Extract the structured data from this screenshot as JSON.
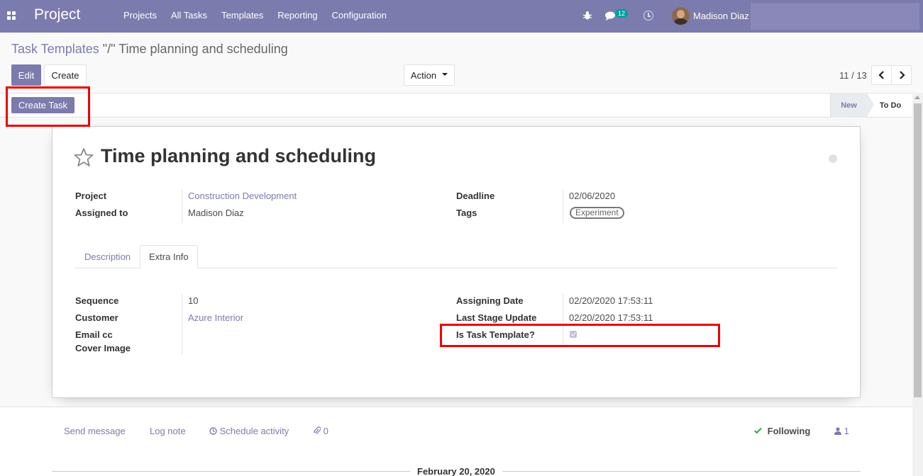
{
  "navbar": {
    "app_name": "Project",
    "menu": [
      "Projects",
      "All Tasks",
      "Templates",
      "Reporting",
      "Configuration"
    ],
    "chat_count": "12",
    "user_name": "Madison Diaz",
    "accent": "#7c7bad"
  },
  "breadcrumb": {
    "parent": "Task Templates",
    "separator": "\"/\"",
    "current": "Time planning and scheduling"
  },
  "buttons": {
    "edit": "Edit",
    "create": "Create",
    "action": "Action",
    "create_task": "Create Task"
  },
  "pager": {
    "value": "11 / 13"
  },
  "stages": {
    "new": "New",
    "todo": "To Do",
    "current": "New"
  },
  "record": {
    "title": "Time planning and scheduling",
    "project_label": "Project",
    "project_value": "Construction Development",
    "assigned_label": "Assigned to",
    "assigned_value": "Madison Diaz",
    "deadline_label": "Deadline",
    "deadline_value": "02/06/2020",
    "tags_label": "Tags",
    "tags_value": "Experiment"
  },
  "tabs": {
    "description": "Description",
    "extra_info": "Extra Info",
    "active": "Extra Info"
  },
  "extra_info": {
    "sequence_label": "Sequence",
    "sequence_value": "10",
    "customer_label": "Customer",
    "customer_value": "Azure Interior",
    "email_cc_label": "Email cc",
    "cover_image_label": "Cover Image",
    "assigning_date_label": "Assigning Date",
    "assigning_date_value": "02/20/2020 17:53:11",
    "last_stage_update_label": "Last Stage Update",
    "last_stage_update_value": "02/20/2020 17:53:11",
    "is_task_template_label": "Is Task Template?",
    "is_task_template_value": true
  },
  "chatter": {
    "send_message": "Send message",
    "log_note": "Log note",
    "schedule_activity": "Schedule activity",
    "attachments": "0",
    "following": "Following",
    "followers": "1",
    "date": "February 20, 2020"
  }
}
